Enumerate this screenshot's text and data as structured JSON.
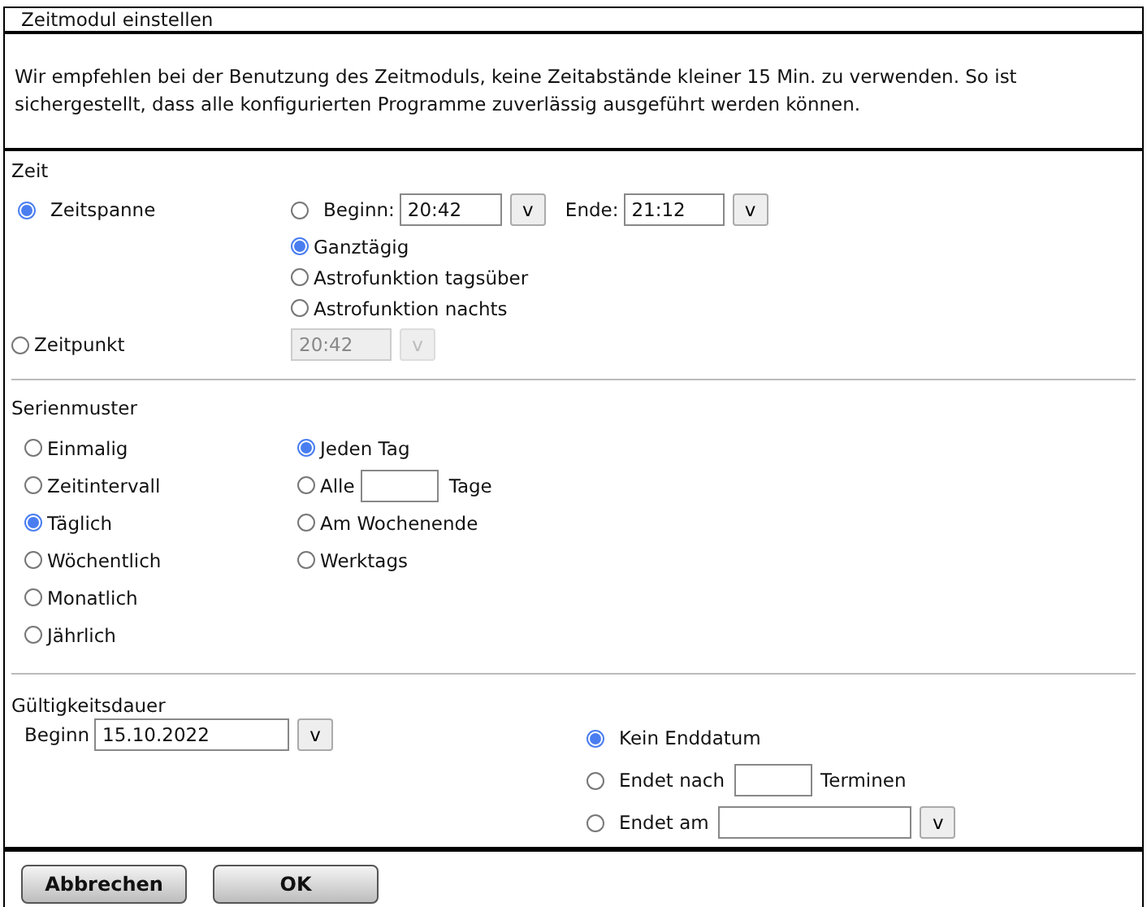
{
  "window": {
    "title": "Zeitmodul einstellen"
  },
  "notice": "Wir empfehlen bei der Benutzung des Zeitmoduls, keine Zeitabstände kleiner 15 Min. zu verwenden.  So ist sichergestellt, dass alle konfigurierten Programme zuverlässig ausgeführt werden können.",
  "zeit": {
    "heading": "Zeit",
    "zeitspanne": {
      "label": "Zeitspanne",
      "selected": true,
      "begin": {
        "label": "Beginn:",
        "selected": false,
        "value": "20:42",
        "button": "v"
      },
      "end": {
        "label": "Ende:",
        "value": "21:12",
        "button": "v"
      },
      "options": [
        {
          "label": "Ganztägig",
          "selected": true
        },
        {
          "label": "Astrofunktion tagsüber",
          "selected": false
        },
        {
          "label": "Astrofunktion nachts",
          "selected": false
        }
      ]
    },
    "zeitpunkt": {
      "label": "Zeitpunkt",
      "selected": false,
      "value": "20:42",
      "button": "v",
      "disabled": true
    }
  },
  "serienmuster": {
    "heading": "Serienmuster",
    "patterns": [
      {
        "label": "Einmalig",
        "selected": false
      },
      {
        "label": "Zeitintervall",
        "selected": false
      },
      {
        "label": "Täglich",
        "selected": true
      },
      {
        "label": "Wöchentlich",
        "selected": false
      },
      {
        "label": "Monatlich",
        "selected": false
      },
      {
        "label": "Jährlich",
        "selected": false
      }
    ],
    "daily_options": [
      {
        "kind": "plain",
        "label": "Jeden Tag",
        "selected": true
      },
      {
        "kind": "every",
        "label": "Alle",
        "suffix": "Tage",
        "selected": false
      },
      {
        "kind": "plain",
        "label": "Am Wochenende",
        "selected": false
      },
      {
        "kind": "plain",
        "label": "Werktags",
        "selected": false
      }
    ]
  },
  "gueltigkeit": {
    "heading": "Gültigkeitsdauer",
    "begin": {
      "label": "Beginn",
      "value": "15.10.2022",
      "button": "v"
    },
    "end_options": [
      {
        "kind": "plain",
        "label": "Kein Enddatum",
        "selected": true
      },
      {
        "kind": "count",
        "label": "Endet nach",
        "suffix": "Terminen",
        "selected": false
      },
      {
        "kind": "date",
        "label": "Endet am",
        "button": "v",
        "selected": false
      }
    ]
  },
  "buttons": [
    "Abbrechen",
    "OK"
  ]
}
